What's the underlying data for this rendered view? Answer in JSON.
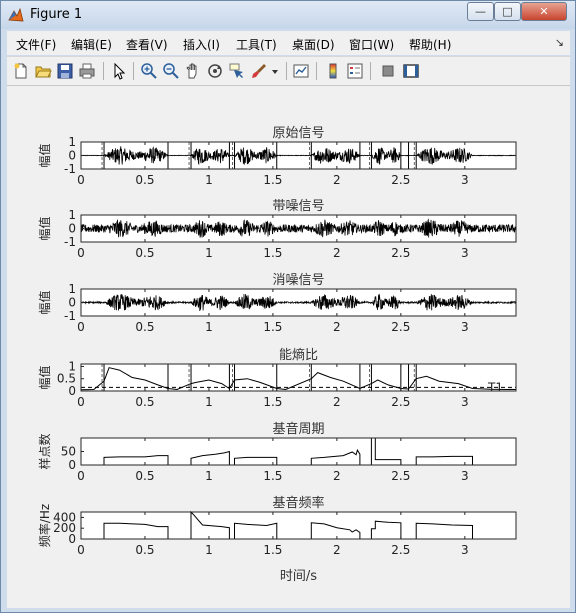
{
  "window": {
    "title": "Figure 1",
    "controls": {
      "minimize": "—",
      "maximize": "□",
      "close": "✕"
    }
  },
  "menu": [
    "文件(F)",
    "编辑(E)",
    "查看(V)",
    "插入(I)",
    "工具(T)",
    "桌面(D)",
    "窗口(W)",
    "帮助(H)"
  ],
  "toolbar_icons": [
    "new-figure-icon",
    "open-file-icon",
    "save-icon",
    "print-icon",
    "pointer-icon",
    "zoom-in-icon",
    "zoom-out-icon",
    "pan-icon",
    "rotate-3d-icon",
    "data-cursor-icon",
    "brush-icon",
    "dropdown-arrow-icon",
    "link-plot-icon",
    "colorbar-icon",
    "legend-icon",
    "hide-plot-tools-icon",
    "show-plot-tools-icon"
  ],
  "xlabel": "时间/s",
  "x_ticks": [
    "0",
    "0.5",
    "1",
    "1.5",
    "2",
    "2.5",
    "3"
  ],
  "boundaries": [
    0.18,
    0.68,
    0.86,
    1.16,
    1.2,
    1.53,
    1.8,
    2.18,
    2.27,
    2.5,
    2.56,
    2.62
  ],
  "chart_data": [
    {
      "type": "line",
      "title": "原始信号",
      "ylabel": "幅值",
      "xlim": [
        0,
        3.4
      ],
      "ylim": [
        -1,
        1
      ],
      "y_ticks": [
        "1",
        "0",
        "-1"
      ],
      "speech_segments": [
        [
          0.18,
          0.68
        ],
        [
          0.86,
          1.16
        ],
        [
          1.2,
          1.53
        ],
        [
          1.8,
          2.18
        ],
        [
          2.27,
          2.5
        ],
        [
          2.62,
          3.06
        ]
      ],
      "noise_level": 0.02,
      "amplitude": 0.95
    },
    {
      "type": "line",
      "title": "带噪信号",
      "ylabel": "幅值",
      "xlim": [
        0,
        3.4
      ],
      "ylim": [
        -1,
        1
      ],
      "y_ticks": [
        "1",
        "0",
        "-1"
      ],
      "speech_segments": [
        [
          0.18,
          0.68
        ],
        [
          0.86,
          1.16
        ],
        [
          1.2,
          1.53
        ],
        [
          1.8,
          2.18
        ],
        [
          2.27,
          2.5
        ],
        [
          2.62,
          3.06
        ]
      ],
      "noise_level": 0.3,
      "amplitude": 0.95
    },
    {
      "type": "line",
      "title": "消噪信号",
      "ylabel": "幅值",
      "xlim": [
        0,
        3.4
      ],
      "ylim": [
        -1,
        1
      ],
      "y_ticks": [
        "1",
        "0",
        "-1"
      ],
      "speech_segments": [
        [
          0.18,
          0.68
        ],
        [
          0.86,
          1.16
        ],
        [
          1.2,
          1.53
        ],
        [
          1.8,
          2.18
        ],
        [
          2.27,
          2.5
        ],
        [
          2.62,
          3.06
        ]
      ],
      "noise_level": 0.06,
      "amplitude": 0.9
    },
    {
      "type": "line",
      "title": "能熵比",
      "ylabel": "幅值",
      "xlim": [
        0,
        3.4
      ],
      "ylim": [
        0,
        1.1
      ],
      "y_ticks": [
        "1",
        "0.5",
        "0"
      ],
      "threshold": 0.15,
      "threshold_label": "T1",
      "x": [
        0,
        0.1,
        0.18,
        0.22,
        0.3,
        0.4,
        0.5,
        0.6,
        0.68,
        0.75,
        0.86,
        0.9,
        1.0,
        1.1,
        1.16,
        1.2,
        1.3,
        1.4,
        1.53,
        1.6,
        1.8,
        1.85,
        1.95,
        2.05,
        2.18,
        2.27,
        2.32,
        2.4,
        2.5,
        2.56,
        2.62,
        2.7,
        2.8,
        2.95,
        3.06,
        3.2,
        3.4
      ],
      "y": [
        0.05,
        0.06,
        0.4,
        0.95,
        0.85,
        0.55,
        0.45,
        0.25,
        0.1,
        0.06,
        0.3,
        0.35,
        0.45,
        0.3,
        0.1,
        0.45,
        0.5,
        0.35,
        0.1,
        0.06,
        0.5,
        0.75,
        0.55,
        0.4,
        0.1,
        0.3,
        0.45,
        0.25,
        0.1,
        0.08,
        0.5,
        0.6,
        0.4,
        0.3,
        0.1,
        0.07,
        0.06
      ]
    },
    {
      "type": "line",
      "title": "基音周期",
      "ylabel": "样点数",
      "xlim": [
        0,
        3.4
      ],
      "ylim": [
        0,
        100
      ],
      "y_ticks": [
        "50",
        "0"
      ],
      "x": [
        0,
        0.18,
        0.18,
        0.3,
        0.5,
        0.6,
        0.68,
        0.68,
        0.86,
        0.86,
        0.95,
        1.05,
        1.12,
        1.16,
        1.16,
        1.2,
        1.2,
        1.3,
        1.45,
        1.53,
        1.53,
        1.8,
        1.8,
        1.9,
        2.05,
        2.12,
        2.15,
        2.16,
        2.18,
        2.18,
        2.27,
        2.27,
        2.3,
        2.3,
        2.4,
        2.5,
        2.5,
        2.62,
        2.62,
        2.75,
        2.9,
        3.06,
        3.06,
        3.4
      ],
      "y": [
        0,
        0,
        28,
        30,
        30,
        35,
        35,
        0,
        0,
        25,
        35,
        40,
        45,
        50,
        0,
        0,
        25,
        28,
        28,
        28,
        0,
        0,
        25,
        28,
        35,
        48,
        38,
        55,
        40,
        0,
        0,
        100,
        100,
        20,
        20,
        20,
        0,
        0,
        30,
        30,
        32,
        32,
        0,
        0
      ]
    },
    {
      "type": "line",
      "title": "基音频率",
      "ylabel": "频率/Hz",
      "xlim": [
        0,
        3.4
      ],
      "ylim": [
        0,
        500
      ],
      "y_ticks": [
        "400",
        "200",
        "0"
      ],
      "x": [
        0,
        0.18,
        0.18,
        0.3,
        0.5,
        0.6,
        0.68,
        0.68,
        0.86,
        0.86,
        0.88,
        0.95,
        1.1,
        1.16,
        1.16,
        1.2,
        1.2,
        1.3,
        1.45,
        1.53,
        1.53,
        1.8,
        1.8,
        1.9,
        2.0,
        2.1,
        2.12,
        2.15,
        2.18,
        2.18,
        2.27,
        2.27,
        2.3,
        2.3,
        2.4,
        2.5,
        2.5,
        2.62,
        2.62,
        2.75,
        2.9,
        3.06,
        3.06,
        3.4
      ],
      "y": [
        0,
        0,
        290,
        290,
        270,
        230,
        230,
        0,
        0,
        500,
        450,
        260,
        230,
        210,
        0,
        0,
        290,
        270,
        250,
        290,
        0,
        0,
        300,
        280,
        210,
        170,
        130,
        170,
        120,
        0,
        0,
        190,
        190,
        330,
        310,
        300,
        0,
        0,
        290,
        280,
        260,
        250,
        0,
        0
      ]
    }
  ]
}
